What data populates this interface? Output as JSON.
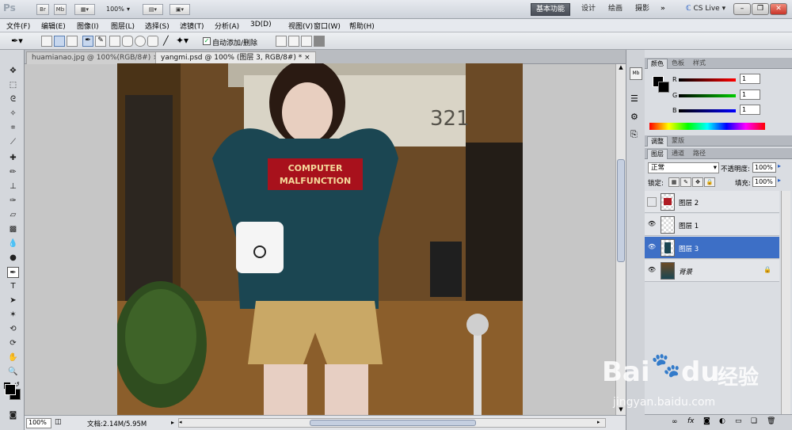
{
  "app": {
    "logo": "Ps",
    "btn_br": "Br",
    "btn_mb": "Mb",
    "zoom": "100%"
  },
  "workspace": {
    "active": "基本功能",
    "items": [
      "设计",
      "绘画",
      "摄影"
    ],
    "more": "»",
    "cslive": "CS Live"
  },
  "menu": [
    "文件(F)",
    "编辑(E)",
    "图像(I)",
    "图层(L)",
    "选择(S)",
    "滤镜(T)",
    "分析(A)",
    "3D(D)",
    "视图(V)",
    "窗口(W)",
    "帮助(H)"
  ],
  "options": {
    "auto_add_label": "自动添加/删除",
    "auto_add_checked": "✓"
  },
  "tabs": [
    {
      "label": "huamianao.jpg @ 100%(RGB/8#)",
      "close": "×"
    },
    {
      "label": "yangmi.psd @ 100% (图层 3, RGB/8#) *",
      "close": "×"
    }
  ],
  "photo": {
    "shirt_text_1": "COMPUTER",
    "shirt_text_2": "MALFUNCTION",
    "sign_text": "321"
  },
  "status": {
    "zoom": "100%",
    "doc": "文档:2.14M/5.95M"
  },
  "color_panel": {
    "tabs": [
      "颜色",
      "色板",
      "样式"
    ],
    "r_label": "R",
    "g_label": "G",
    "b_label": "B",
    "r_value": "1",
    "g_value": "1",
    "b_value": "1"
  },
  "adjust_panel": {
    "tabs": [
      "调整",
      "蒙版"
    ]
  },
  "layers_panel": {
    "tabs": [
      "图层",
      "通道",
      "路径"
    ],
    "blend_mode": "正常",
    "opacity_label": "不透明度:",
    "opacity": "100%",
    "lock_label": "锁定:",
    "fill_label": "填充:",
    "fill": "100%",
    "layers": [
      {
        "name": "图层 2",
        "visible": false,
        "selected": false
      },
      {
        "name": "图层 1",
        "visible": true,
        "selected": false
      },
      {
        "name": "图层 3",
        "visible": true,
        "selected": true
      },
      {
        "name": "背景",
        "visible": true,
        "selected": false,
        "locked": true
      }
    ]
  },
  "watermark": {
    "brand": "Bai",
    "brand2": "du",
    "paw": "🐾",
    "cn": "经验",
    "url": "jingyan.baidu.com"
  }
}
